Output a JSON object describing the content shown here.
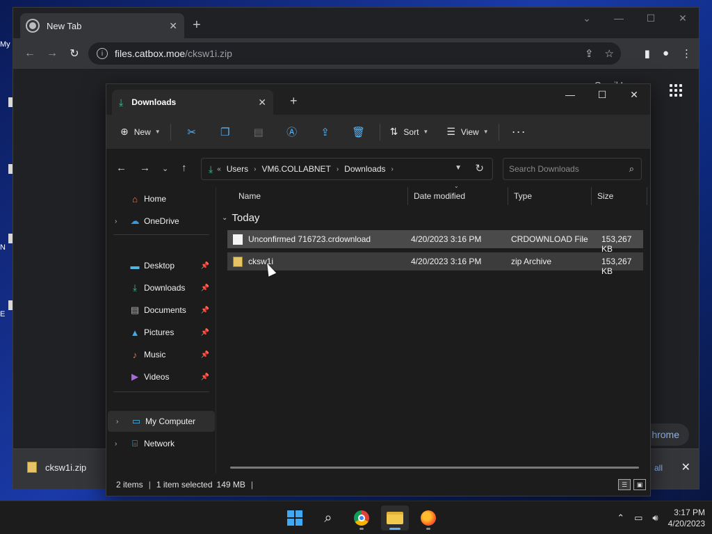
{
  "desktop": {
    "icon_labels": [
      "My",
      "",
      "",
      "N",
      "E"
    ]
  },
  "chrome": {
    "tab_title": "New Tab",
    "tab_close": "✕",
    "new_tab": "+",
    "url_host": "files.catbox.moe",
    "url_path": "/cksw1i.zip",
    "header_links": "Gmail    Images",
    "customize_label": "hrome",
    "download_bar": {
      "filename": "cksw1i.zip",
      "show_all": "all"
    }
  },
  "explorer": {
    "tab_title": "Downloads",
    "toolbar": {
      "new_label": "New",
      "sort_label": "Sort",
      "view_label": "View",
      "more_label": "···"
    },
    "address": {
      "crumbs": [
        "Users",
        "VM6.COLLABNET",
        "Downloads"
      ]
    },
    "search_placeholder": "Search Downloads",
    "nav": {
      "home": "Home",
      "onedrive": "OneDrive",
      "desktop": "Desktop",
      "downloads": "Downloads",
      "documents": "Documents",
      "pictures": "Pictures",
      "music": "Music",
      "videos": "Videos",
      "my_computer": "My Computer",
      "network": "Network"
    },
    "columns": {
      "name": "Name",
      "date": "Date modified",
      "type": "Type",
      "size": "Size"
    },
    "group_label": "Today",
    "files": [
      {
        "name": "Unconfirmed 716723.crdownload",
        "date": "4/20/2023 3:16 PM",
        "type": "CRDOWNLOAD File",
        "size": "153,267 KB"
      },
      {
        "name": "cksw1i",
        "date": "4/20/2023 3:16 PM",
        "type": "zip Archive",
        "size": "153,267 KB"
      }
    ],
    "status": {
      "items": "2 items",
      "selected": "1 item selected",
      "size": "149 MB"
    }
  },
  "taskbar": {
    "time": "3:17 PM",
    "date": "4/20/2023"
  }
}
